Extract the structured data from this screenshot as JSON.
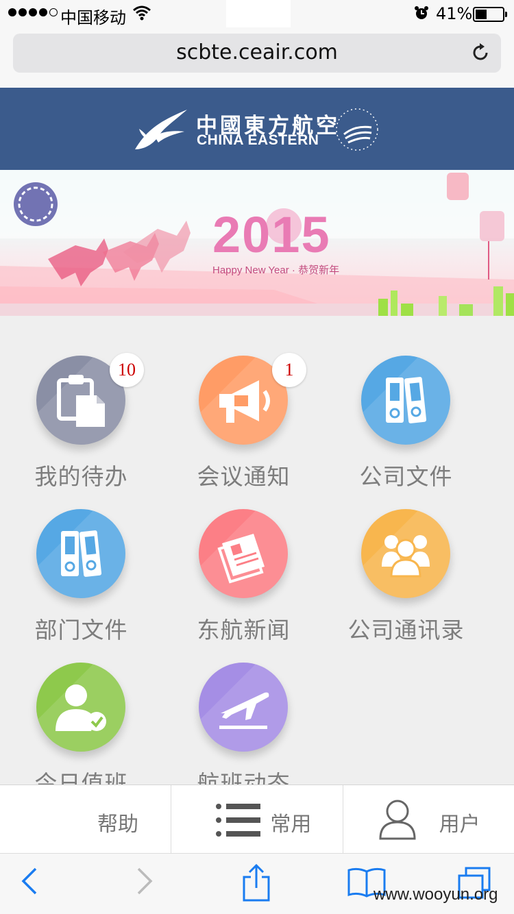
{
  "status_bar": {
    "carrier": "中国移动",
    "battery_percent": "41%",
    "battery_level": 0.41,
    "signal_bars_filled": 4,
    "icons": [
      "signal-dots",
      "wifi-icon",
      "alarm-icon",
      "battery-icon"
    ]
  },
  "browser": {
    "url": "scbte.ceair.com",
    "reload_icon": "reload-icon"
  },
  "header": {
    "brand_cn": "中國東方航空",
    "brand_en": "CHINA EASTERN",
    "alliance": "SKYTEAM"
  },
  "banner": {
    "year": "2015",
    "tagline": "Happy New Year · 恭贺新年"
  },
  "tiles": [
    {
      "label": "我的待办",
      "icon": "clipboard-icon",
      "badge": "10",
      "color": "#8a8fa5"
    },
    {
      "label": "会议通知",
      "icon": "megaphone-icon",
      "badge": "1",
      "color": "#ff9c66"
    },
    {
      "label": "公司文件",
      "icon": "binder-icon",
      "badge": "",
      "color": "#56a8e4"
    },
    {
      "label": "部门文件",
      "icon": "binder-icon",
      "badge": "",
      "color": "#56a8e4"
    },
    {
      "label": "东航新闻",
      "icon": "newspaper-icon",
      "badge": "",
      "color": "#fc7f86"
    },
    {
      "label": "公司通讯录",
      "icon": "contacts-group-icon",
      "badge": "",
      "color": "#f8b64e"
    },
    {
      "label": "今日值班",
      "icon": "user-check-icon",
      "badge": "",
      "color": "#8ec94c"
    },
    {
      "label": "航班动态",
      "icon": "plane-takeoff-icon",
      "badge": "",
      "color": "#a58ee5"
    }
  ],
  "tabbar": {
    "help": "帮助",
    "common": "常用",
    "user": "用户"
  },
  "watermark": "www.wooyun.org"
}
